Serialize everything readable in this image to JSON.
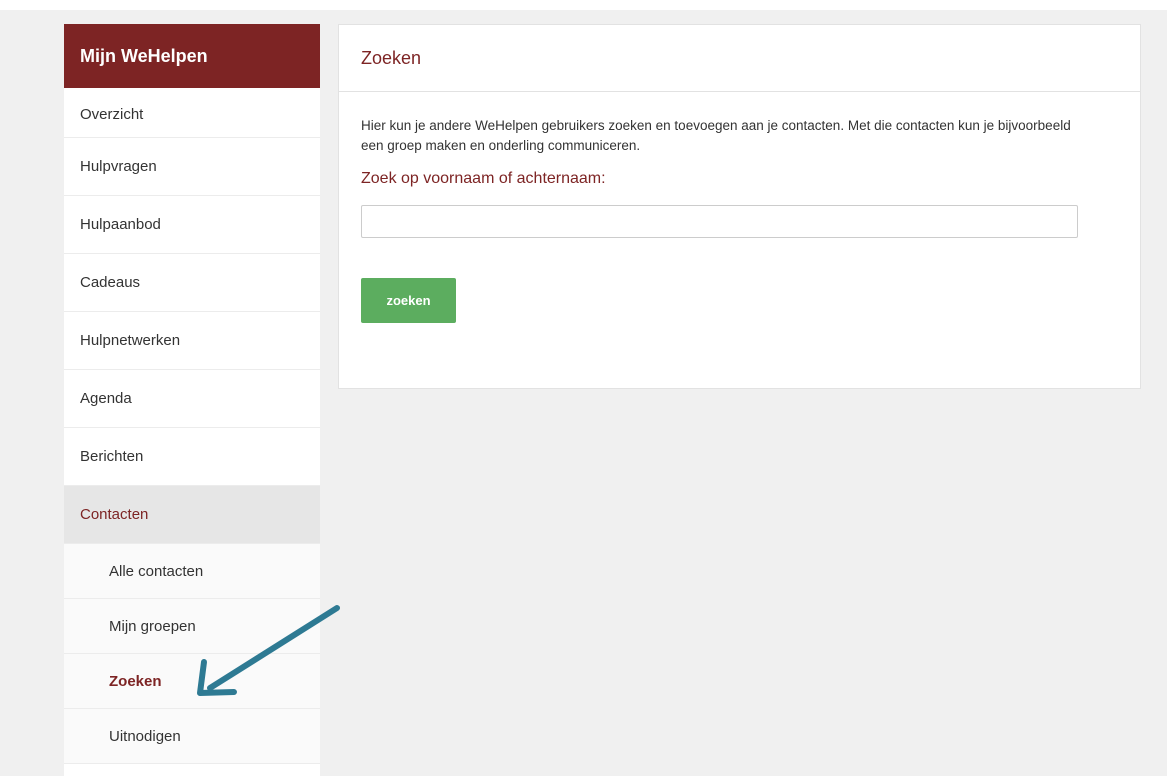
{
  "sidebar": {
    "title": "Mijn WeHelpen",
    "items": [
      {
        "label": "Overzicht"
      },
      {
        "label": "Hulpvragen"
      },
      {
        "label": "Hulpaanbod"
      },
      {
        "label": "Cadeaus"
      },
      {
        "label": "Hulpnetwerken"
      },
      {
        "label": "Agenda"
      },
      {
        "label": "Berichten"
      },
      {
        "label": "Contacten"
      }
    ],
    "sub_items": [
      {
        "label": "Alle contacten"
      },
      {
        "label": "Mijn groepen"
      },
      {
        "label": "Zoeken"
      },
      {
        "label": "Uitnodigen"
      }
    ]
  },
  "main": {
    "title": "Zoeken",
    "intro": "Hier kun je andere WeHelpen gebruikers zoeken en toevoegen aan je contacten. Met die contacten kun je bijvoorbeeld een groep maken en onderling communiceren.",
    "search_label": "Zoek op voornaam of achternaam:",
    "search_value": "",
    "search_button": "zoeken"
  },
  "colors": {
    "brand": "#7d2424",
    "button": "#5cad5f",
    "annotation_arrow": "#2e7a93",
    "background": "#f0f0f0"
  },
  "icons": {
    "annotation": "arrow-pointer-icon"
  }
}
